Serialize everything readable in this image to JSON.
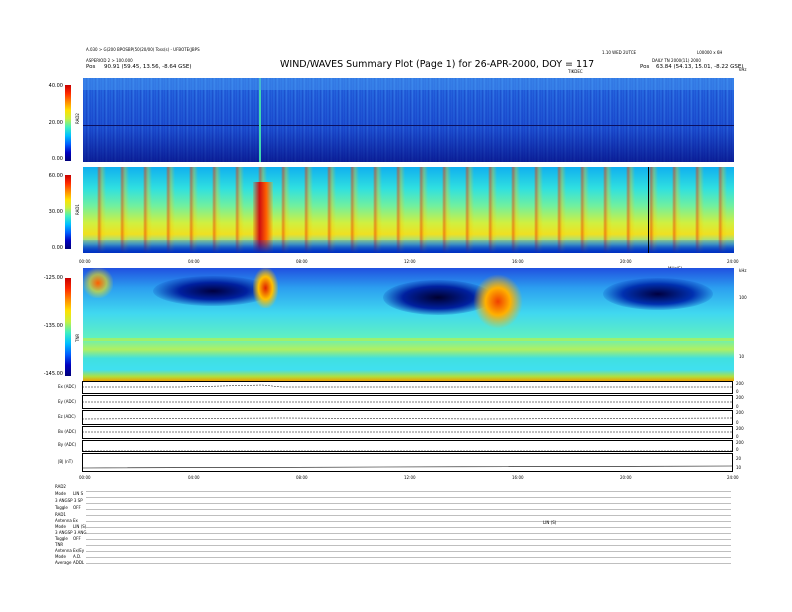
{
  "title": "WIND/WAVES Summary Plot (Page 1) for 26-APR-2000, DOY = 117",
  "header": {
    "left_line1": "A.030 > G(200 BPOSBP(50(20/00) Toss(s) - UFBOTE(JBPS",
    "left_line2": "ASPERIOD 2 > 100.000",
    "left_line3_prefix": "Pos",
    "left_line3": "90.91 (59.45, 13.56, -8.64 GSE)",
    "right_line1": "1.10 WED 2UTCE",
    "right_line2": "L00000 x 6H",
    "right_line3": "DAILY TN 2000(11) 2000",
    "right_line4_prefix": "Pos",
    "right_line4": "63.84 (54.13, 15.01, -8.22 GSE)",
    "rad2_top": "TIKDEC",
    "unit_top": "kHz"
  },
  "panels": {
    "rad2": {
      "name": "RAD2",
      "ticks": [
        "40.00",
        "20.00",
        "0.00"
      ],
      "range": [
        0,
        40
      ]
    },
    "rad1": {
      "name": "RAD1",
      "ticks": [
        "60.00",
        "30.00",
        "0.00"
      ],
      "range": [
        0,
        60
      ]
    },
    "tnr": {
      "name": "TNR",
      "ticks": [
        "-125.00",
        "-135.00",
        "-145.00"
      ],
      "range": [
        -145,
        -125
      ],
      "right_ticks": [
        "100",
        "10"
      ],
      "right_top": "kHz",
      "top_label": "MHz(E)"
    },
    "lines": [
      {
        "name": "Ex (ADC)",
        "right": [
          "200",
          "0"
        ]
      },
      {
        "name": "Ey (ADC)",
        "right": [
          "200",
          "0"
        ]
      },
      {
        "name": "Ez (ADC)",
        "right": [
          "200",
          "0"
        ]
      },
      {
        "name": "Bx (ADC)",
        "right": [
          "200",
          "0"
        ]
      },
      {
        "name": "By (ADC)",
        "right": [
          "200",
          "0"
        ]
      },
      {
        "name": "|B| (nT)",
        "right": [
          "20",
          "10"
        ]
      }
    ]
  },
  "time_axis_1": [
    "00:00",
    "04:00",
    "08:00",
    "12:00",
    "16:00",
    "20:00",
    "24:00"
  ],
  "time_axis_2": [
    "00:00",
    "04:00",
    "08:00",
    "12:00",
    "16:00",
    "20:00",
    "24:00"
  ],
  "status": [
    {
      "label": "RAD2",
      "value": ""
    },
    {
      "label": "Mode",
      "value": "LIN S"
    },
    {
      "label": "3 ANGSP 3 SP",
      "value": "3"
    },
    {
      "label": "Toggle",
      "value": "OFF"
    },
    {
      "label": "RAD1",
      "value": ""
    },
    {
      "label": "Antenna",
      "value": "Ex"
    },
    {
      "label": "Mode",
      "value": "LIN (S)"
    },
    {
      "label": "3 ANGSP 3 ANG",
      "value": ""
    },
    {
      "label": "Toggle",
      "value": "OFF"
    },
    {
      "label": "TNR",
      "value": ""
    },
    {
      "label": "Antenna",
      "value": "Ex/Ey"
    },
    {
      "label": "Mode",
      "value": "A.D."
    },
    {
      "label": "Average",
      "value": "ADDL"
    }
  ],
  "status_mid": "LIN (S)",
  "chart_data": {
    "type": "heatmap",
    "title": "WIND/WAVES Summary Plot (Page 1) for 26-APR-2000, DOY = 117",
    "x_ticks": [
      "00:00",
      "04:00",
      "08:00",
      "12:00",
      "16:00",
      "20:00",
      "24:00"
    ],
    "panels": [
      {
        "name": "RAD2",
        "ylim": [
          0,
          40
        ],
        "y_ticks": [
          0,
          20,
          40
        ]
      },
      {
        "name": "RAD1",
        "ylim": [
          0,
          60
        ],
        "y_ticks": [
          0,
          30,
          60
        ]
      },
      {
        "name": "TNR",
        "ylim": [
          -145,
          -125
        ],
        "y_ticks": [
          -145,
          -135,
          -125
        ]
      }
    ],
    "time_series": [
      "Ex (ADC)",
      "Ey (ADC)",
      "Ez (ADC)",
      "Bx (ADC)",
      "By (ADC)",
      "|B| (nT)"
    ]
  }
}
